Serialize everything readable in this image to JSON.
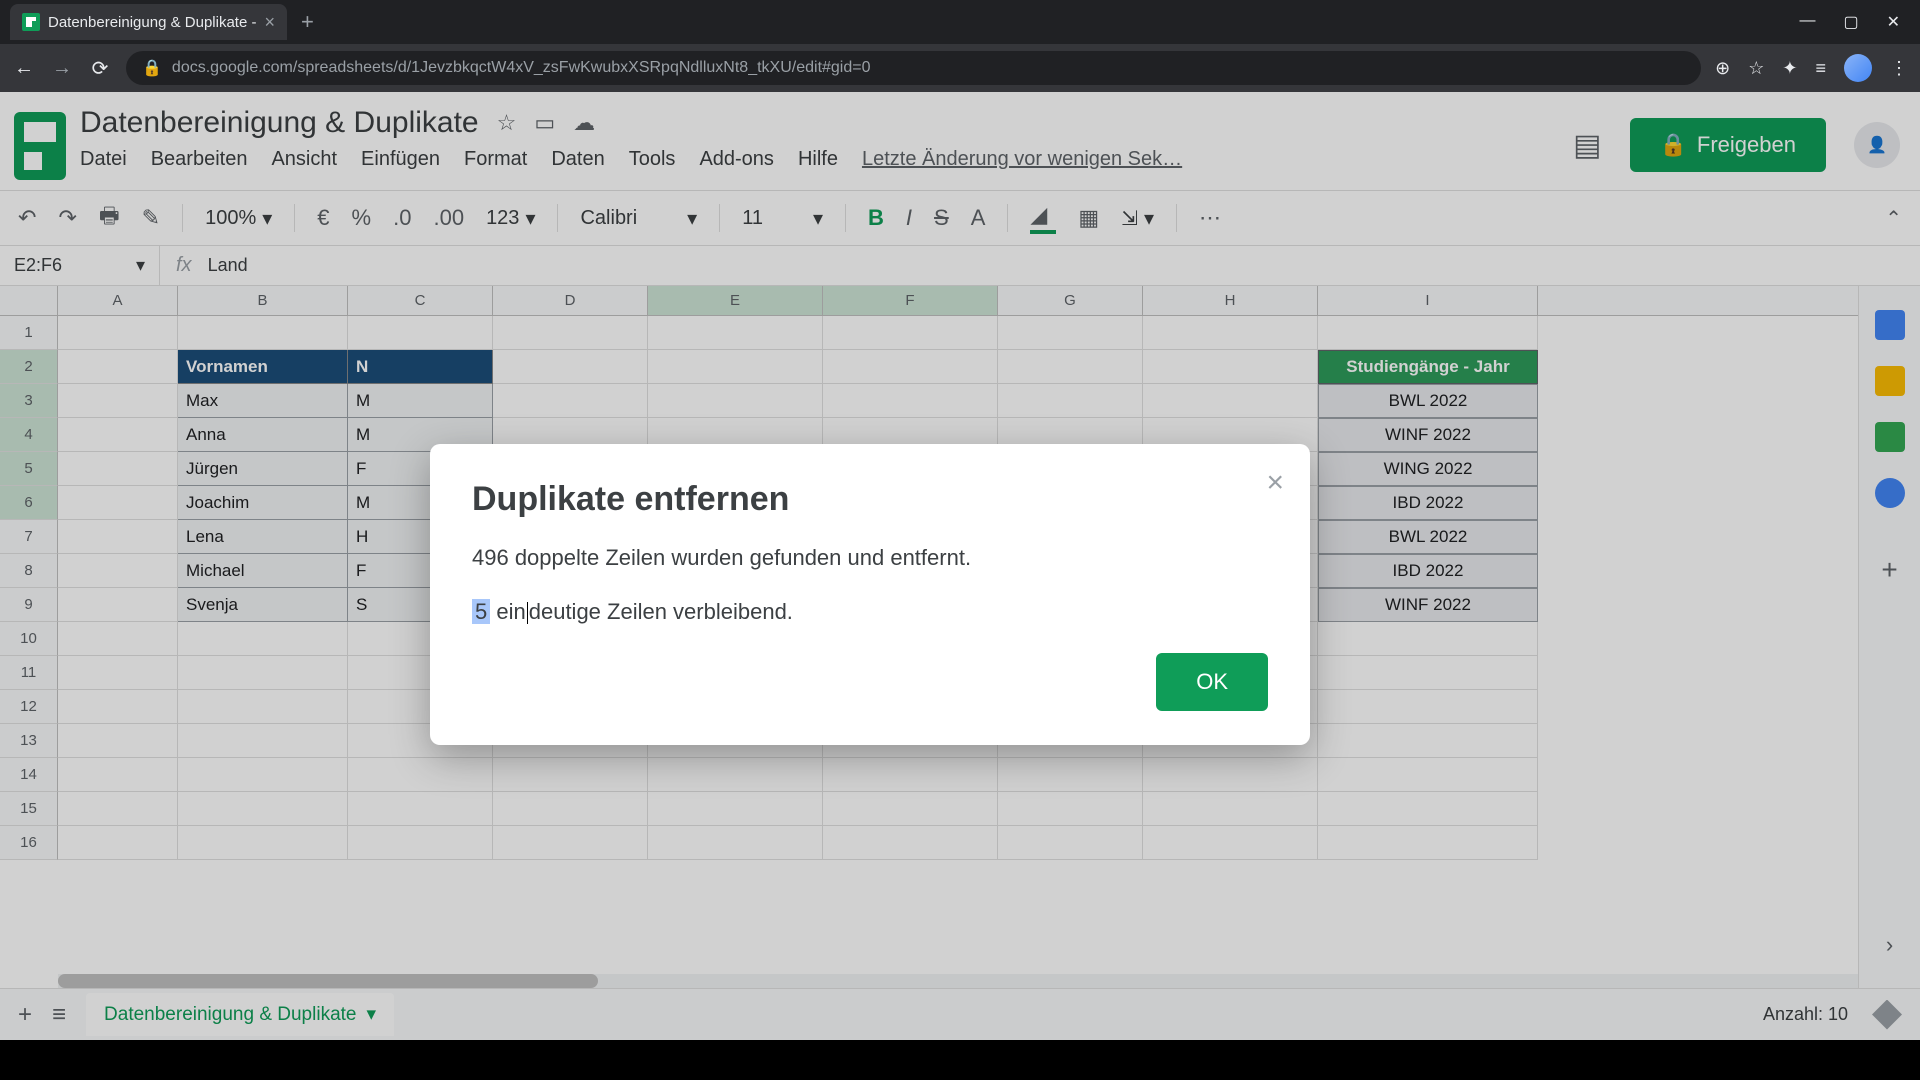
{
  "browser": {
    "tab_title": "Datenbereinigung & Duplikate -",
    "url": "docs.google.com/spreadsheets/d/1JevzbkqctW4xV_zsFwKwubxXSRpqNdlluxNt8_tkXU/edit#gid=0"
  },
  "header": {
    "doc_title": "Datenbereinigung & Duplikate",
    "menus": {
      "file": "Datei",
      "edit": "Bearbeiten",
      "view": "Ansicht",
      "insert": "Einfügen",
      "format": "Format",
      "data": "Daten",
      "tools": "Tools",
      "addons": "Add-ons",
      "help": "Hilfe"
    },
    "last_edit": "Letzte Änderung vor wenigen Sek…",
    "share_label": "Freigeben"
  },
  "toolbar": {
    "zoom": "100%",
    "currency": "€",
    "percent": "%",
    "dec_less": ".0",
    "dec_more": ".00",
    "fmt123": "123",
    "font": "Calibri",
    "font_size": "11",
    "bold": "B",
    "italic": "I",
    "strike": "S",
    "textcolor": "A"
  },
  "namebox": {
    "ref": "E2:F6",
    "fx_value": "Land"
  },
  "columns": [
    "A",
    "B",
    "C",
    "D",
    "E",
    "F",
    "G",
    "H",
    "I"
  ],
  "rows": [
    1,
    2,
    3,
    4,
    5,
    6,
    7,
    8,
    9,
    10,
    11,
    12,
    13,
    14,
    15,
    16
  ],
  "selected_cols": [
    "E",
    "F"
  ],
  "selected_rows": [
    2,
    3,
    4,
    5,
    6
  ],
  "table": {
    "headers": {
      "b": "Vornamen",
      "c_first": "N"
    },
    "col_b": [
      "Max",
      "Anna",
      "Jürgen",
      "Joachim",
      "Lena",
      "Michael",
      "Svenja"
    ],
    "col_c_first": [
      "M",
      "M",
      "F",
      "M",
      "H",
      "F",
      "S"
    ]
  },
  "side_table": {
    "header": "Studiengänge - Jahr",
    "rows": [
      "BWL 2022",
      "WINF 2022",
      "WING 2022",
      "IBD 2022",
      "BWL 2022",
      "IBD 2022",
      "WINF 2022"
    ]
  },
  "modal": {
    "title": "Duplikate entfernen",
    "line1": "496 doppelte Zeilen wurden gefunden und entfernt.",
    "highlight": "5",
    "line2_pre": "ein",
    "line2_post": "deutige Zeilen verbleibend.",
    "ok": "OK"
  },
  "sheetbar": {
    "tab_name": "Datenbereinigung & Duplikate",
    "count_label": "Anzahl: 10"
  }
}
